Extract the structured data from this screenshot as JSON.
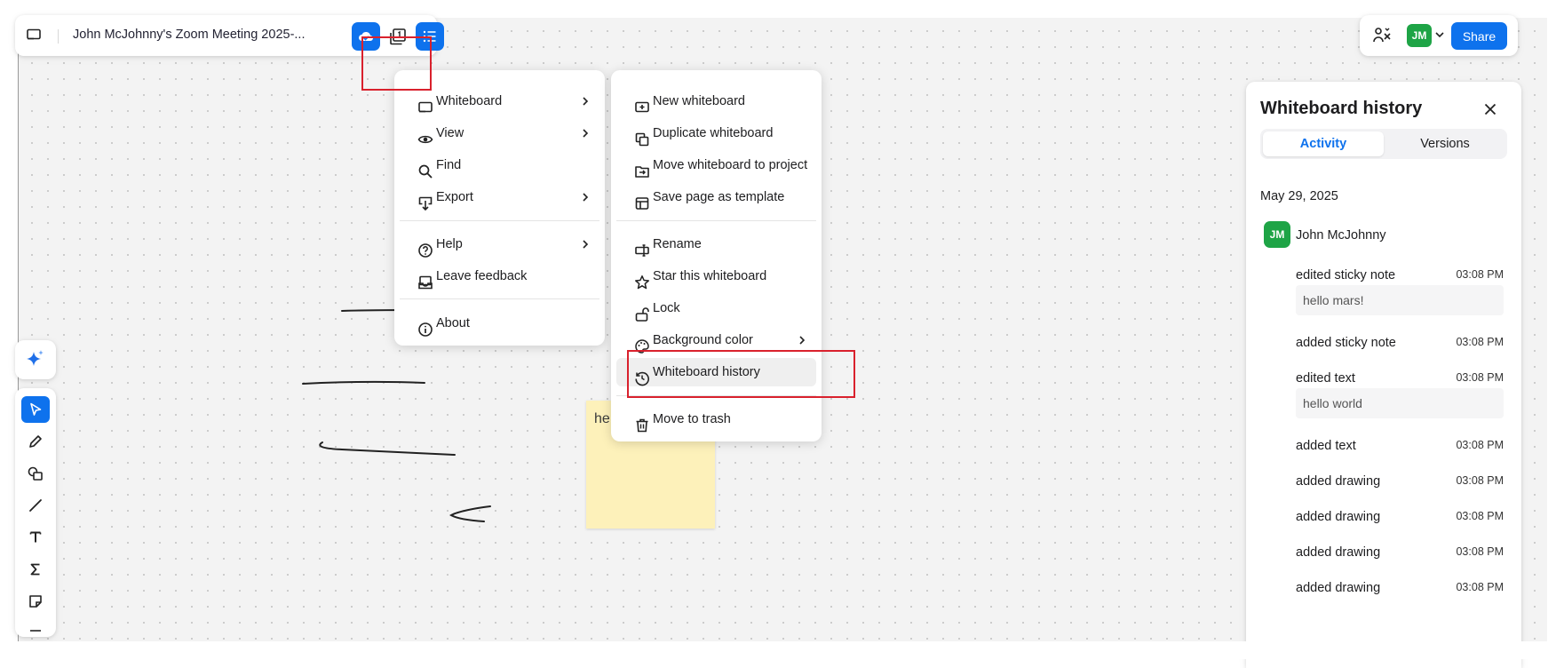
{
  "topbar": {
    "title": "John McJohnny's Zoom Meeting 2025-...",
    "icons": [
      "whiteboard-icon",
      "cloud-save-icon",
      "pages-icon",
      "menu-icon"
    ]
  },
  "topright": {
    "avatar_initials": "JM",
    "share_label": "Share",
    "icons": [
      "collaborators-icon",
      "chevron-down-icon"
    ]
  },
  "menu_main": {
    "items": [
      {
        "label": "Whiteboard",
        "icon": "whiteboard-icon",
        "submenu": true
      },
      {
        "label": "View",
        "icon": "eye-icon",
        "submenu": true
      },
      {
        "label": "Find",
        "icon": "search-icon",
        "submenu": false
      },
      {
        "label": "Export",
        "icon": "export-icon",
        "submenu": true
      },
      {
        "label": "Help",
        "icon": "help-icon",
        "submenu": true
      },
      {
        "label": "Leave feedback",
        "icon": "feedback-icon",
        "submenu": false
      },
      {
        "label": "About",
        "icon": "info-icon",
        "submenu": false
      }
    ]
  },
  "menu_sub": {
    "items": [
      {
        "label": "New whiteboard",
        "icon": "new-whiteboard-icon"
      },
      {
        "label": "Duplicate whiteboard",
        "icon": "duplicate-icon"
      },
      {
        "label": "Move whiteboard to project",
        "icon": "move-folder-icon"
      },
      {
        "label": "Save page as template",
        "icon": "template-icon"
      },
      {
        "label": "Rename",
        "icon": "rename-icon"
      },
      {
        "label": "Star this whiteboard",
        "icon": "star-icon"
      },
      {
        "label": "Lock",
        "icon": "lock-icon"
      },
      {
        "label": "Background color",
        "icon": "palette-icon",
        "submenu": true
      },
      {
        "label": "Whiteboard history",
        "icon": "history-icon",
        "highlighted": true
      },
      {
        "label": "Move to trash",
        "icon": "trash-icon"
      }
    ]
  },
  "sticky_note": {
    "text": "he",
    "color": "#fdf1ba"
  },
  "toolbar": {
    "tools": [
      "select-tool",
      "pen-tool",
      "shapes-tool",
      "line-tool",
      "text-tool",
      "formula-tool",
      "sticky-note-tool"
    ],
    "active_tool": "select-tool"
  },
  "history": {
    "title": "Whiteboard history",
    "tabs": [
      {
        "label": "Activity",
        "active": true
      },
      {
        "label": "Versions",
        "active": false
      }
    ],
    "date": "May 29, 2025",
    "user": {
      "initials": "JM",
      "name": "John McJohnny"
    },
    "entries": [
      {
        "action": "edited sticky note",
        "time": "03:08 PM",
        "content": "hello mars!"
      },
      {
        "action": "added sticky note",
        "time": "03:08 PM"
      },
      {
        "action": "edited text",
        "time": "03:08 PM",
        "content": "hello world"
      },
      {
        "action": "added text",
        "time": "03:08 PM"
      },
      {
        "action": "added drawing",
        "time": "03:08 PM"
      },
      {
        "action": "added drawing",
        "time": "03:08 PM"
      },
      {
        "action": "added drawing",
        "time": "03:08 PM"
      },
      {
        "action": "added drawing",
        "time": "03:08 PM"
      }
    ]
  },
  "colors": {
    "accent": "#0e72ed",
    "avatar": "#1ea446",
    "highlight_box": "#d9212d"
  }
}
